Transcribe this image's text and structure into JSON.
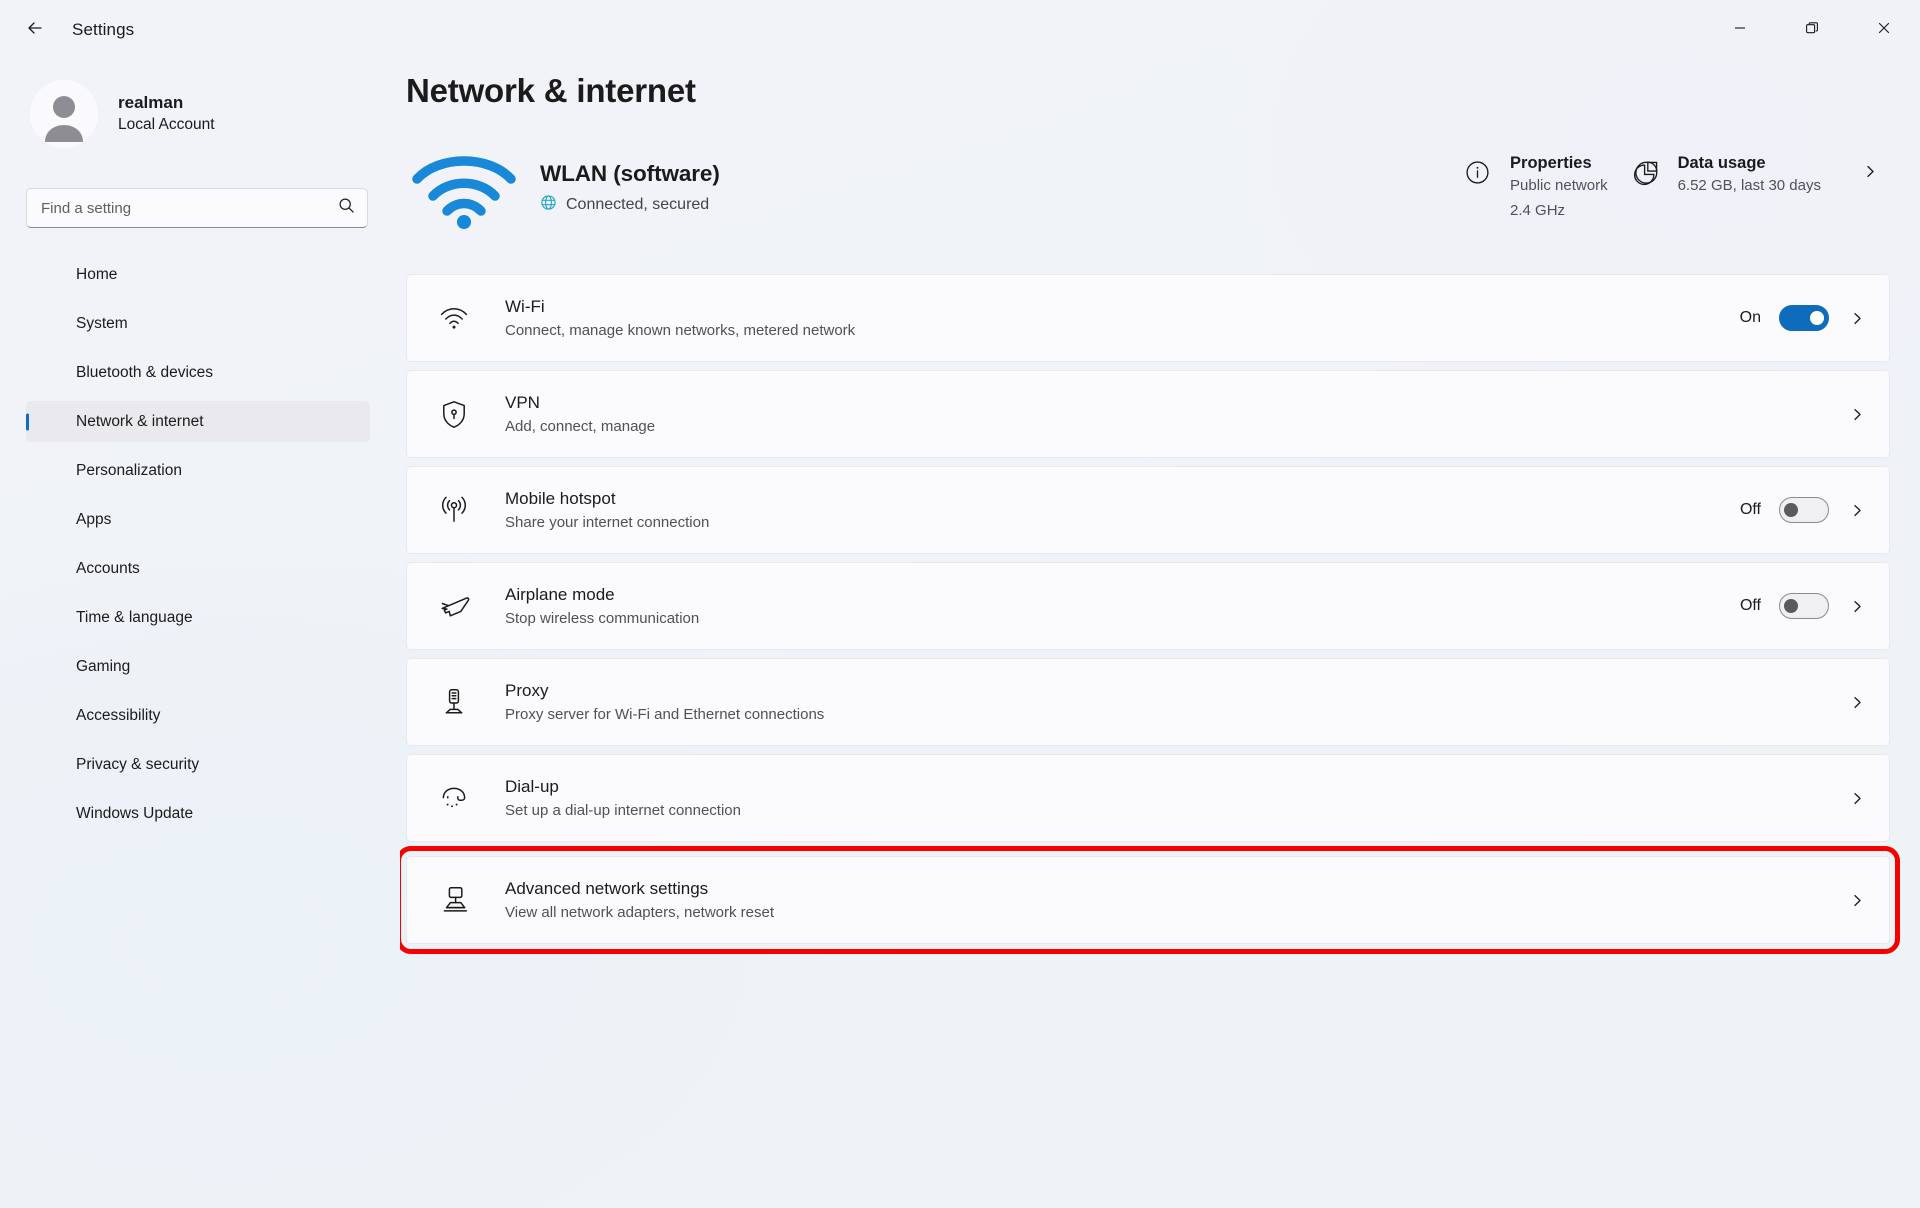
{
  "window": {
    "title": "Settings",
    "back_icon": "arrow-left-icon",
    "controls": {
      "minimize": "minimize-icon",
      "restore": "restore-icon",
      "close": "close-icon"
    }
  },
  "sidebar": {
    "account": {
      "name": "realman",
      "type": "Local Account",
      "avatar_icon": "person-avatar-icon"
    },
    "search": {
      "placeholder": "Find a setting",
      "value": "",
      "icon": "search-icon"
    },
    "items": [
      {
        "label": "Home",
        "selected": false
      },
      {
        "label": "System",
        "selected": false
      },
      {
        "label": "Bluetooth & devices",
        "selected": false
      },
      {
        "label": "Network & internet",
        "selected": true
      },
      {
        "label": "Personalization",
        "selected": false
      },
      {
        "label": "Apps",
        "selected": false
      },
      {
        "label": "Accounts",
        "selected": false
      },
      {
        "label": "Time & language",
        "selected": false
      },
      {
        "label": "Gaming",
        "selected": false
      },
      {
        "label": "Accessibility",
        "selected": false
      },
      {
        "label": "Privacy & security",
        "selected": false
      },
      {
        "label": "Windows Update",
        "selected": false
      }
    ]
  },
  "main": {
    "page_title": "Network & internet",
    "connection": {
      "icon": "wifi-signal-icon",
      "name": "WLAN (software)",
      "status": "Connected, secured",
      "status_icon": "globe-icon"
    },
    "properties": {
      "icon": "info-circle-icon",
      "title": "Properties",
      "line1": "Public network",
      "line2": "2.4 GHz"
    },
    "data_usage": {
      "icon": "pie-chart-icon",
      "title": "Data usage",
      "subtitle": "6.52 GB, last 30 days",
      "chevron": "chevron-right-icon"
    },
    "settings": [
      {
        "icon": "wifi-icon",
        "title": "Wi-Fi",
        "subtitle": "Connect, manage known networks, metered network",
        "toggle": "on",
        "toggle_label": "On",
        "highlighted": false
      },
      {
        "icon": "shield-lock-icon",
        "title": "VPN",
        "subtitle": "Add, connect, manage",
        "toggle": "none",
        "toggle_label": "",
        "highlighted": false
      },
      {
        "icon": "hotspot-icon",
        "title": "Mobile hotspot",
        "subtitle": "Share your internet connection",
        "toggle": "off",
        "toggle_label": "Off",
        "highlighted": false
      },
      {
        "icon": "airplane-icon",
        "title": "Airplane mode",
        "subtitle": "Stop wireless communication",
        "toggle": "off",
        "toggle_label": "Off",
        "highlighted": false
      },
      {
        "icon": "proxy-icon",
        "title": "Proxy",
        "subtitle": "Proxy server for Wi-Fi and Ethernet connections",
        "toggle": "none",
        "toggle_label": "",
        "highlighted": false
      },
      {
        "icon": "dialup-icon",
        "title": "Dial-up",
        "subtitle": "Set up a dial-up internet connection",
        "toggle": "none",
        "toggle_label": "",
        "highlighted": false
      },
      {
        "icon": "monitor-network-icon",
        "title": "Advanced network settings",
        "subtitle": "View all network adapters, network reset",
        "toggle": "none",
        "toggle_label": "",
        "highlighted": true
      }
    ]
  },
  "colors": {
    "accent": "#0f6cbd",
    "wifi_blue": "#1a88d8",
    "highlight_red": "#f60000",
    "selected_bar": "#0d6cc4"
  }
}
